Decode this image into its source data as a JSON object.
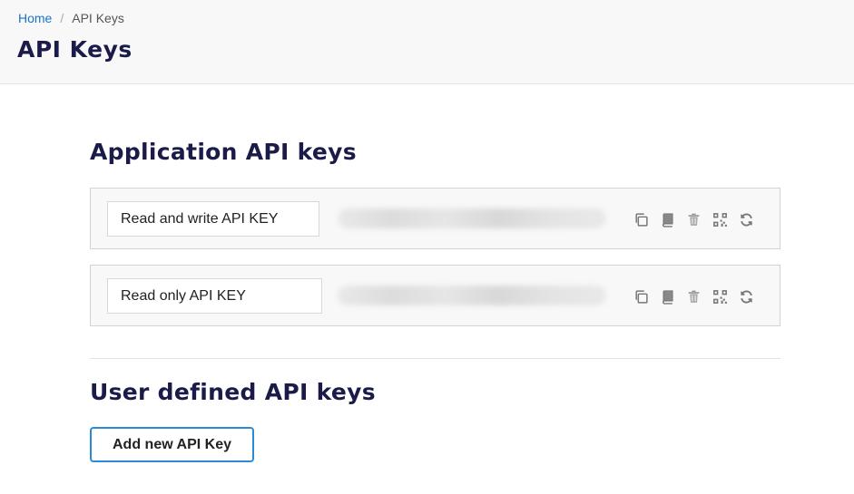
{
  "breadcrumb": {
    "home": "Home",
    "separator": "/",
    "current": "API Keys"
  },
  "page": {
    "title": "API Keys"
  },
  "application_section": {
    "title": "Application API keys",
    "keys": [
      {
        "name": "Read and write API KEY"
      },
      {
        "name": "Read only API KEY"
      }
    ]
  },
  "user_section": {
    "title": "User defined API keys",
    "add_button": "Add new API Key"
  },
  "icons": [
    "copy-icon",
    "book-icon",
    "trash-icon",
    "qr-code-icon",
    "refresh-icon"
  ],
  "colors": {
    "link": "#1a73c9",
    "title": "#1b1b4a",
    "button_border": "#2a8ad8",
    "icon": "#777777"
  }
}
